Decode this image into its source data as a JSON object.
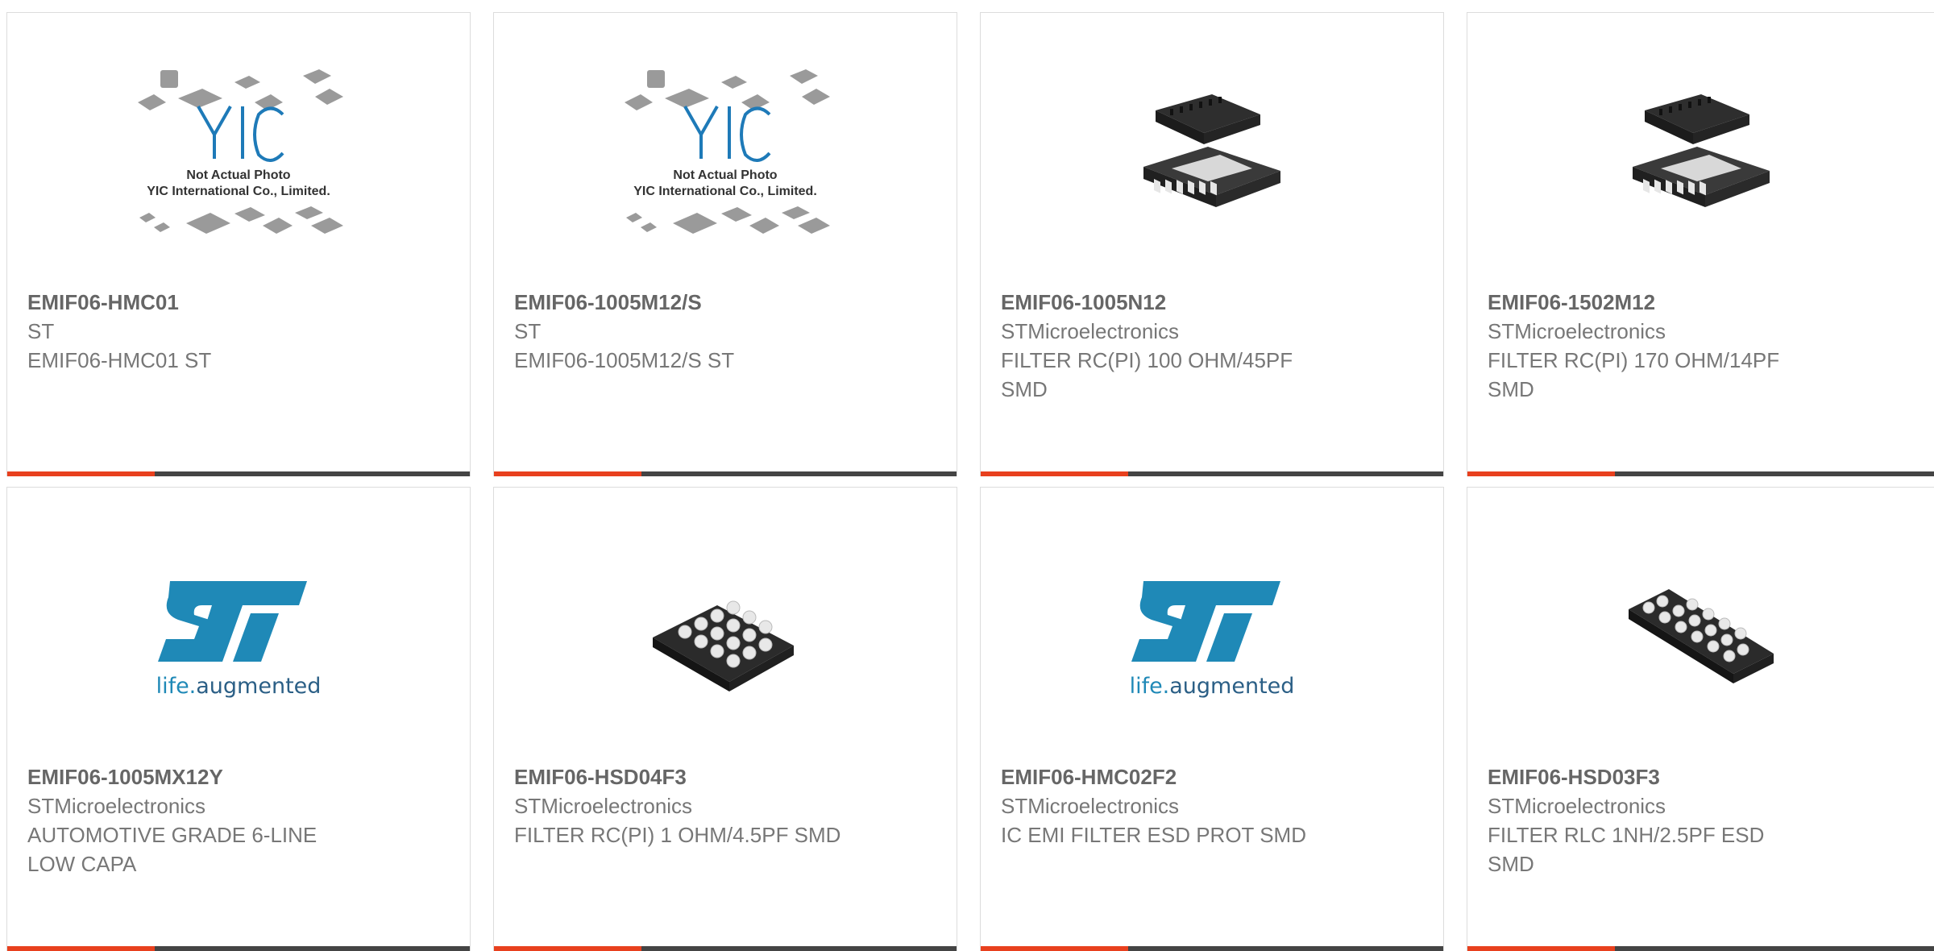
{
  "products": [
    {
      "part": "EMIF06-HMC01",
      "maker": "ST",
      "desc": "EMIF06-HMC01 ST",
      "image": "yic-placeholder",
      "note": [
        "Not Actual Photo",
        "YIC International Co., Limited."
      ]
    },
    {
      "part": "EMIF06-1005M12/S",
      "maker": "ST",
      "desc": "EMIF06-1005M12/S ST",
      "image": "yic-placeholder",
      "note": [
        "Not Actual Photo",
        "YIC International Co., Limited."
      ]
    },
    {
      "part": "EMIF06-1005N12",
      "maker": "STMicroelectronics",
      "desc": "FILTER RC(PI) 100 OHM/45PF SMD",
      "image": "dfn-package"
    },
    {
      "part": "EMIF06-1502M12",
      "maker": "STMicroelectronics",
      "desc": "FILTER RC(PI) 170 OHM/14PF SMD",
      "image": "dfn-package"
    },
    {
      "part": "EMIF06-1005MX12Y",
      "maker": "STMicroelectronics",
      "desc": "AUTOMOTIVE GRADE 6-LINE LOW CAPA",
      "image": "st-logo",
      "tagline": [
        "life.",
        "augmented"
      ]
    },
    {
      "part": "EMIF06-HSD04F3",
      "maker": "STMicroelectronics",
      "desc": "FILTER RC(PI) 1 OHM/4.5PF SMD",
      "image": "bga-square"
    },
    {
      "part": "EMIF06-HMC02F2",
      "maker": "STMicroelectronics",
      "desc": "IC EMI FILTER ESD PROT SMD",
      "image": "st-logo",
      "tagline": [
        "life.",
        "augmented"
      ]
    },
    {
      "part": "EMIF06-HSD03F3",
      "maker": "STMicroelectronics",
      "desc": "FILTER RLC 1NH/2.5PF ESD SMD",
      "image": "bga-rect"
    }
  ],
  "colors": {
    "accent": "#e8401e",
    "bar": "#444444",
    "st_blue": "#1f89b7"
  }
}
